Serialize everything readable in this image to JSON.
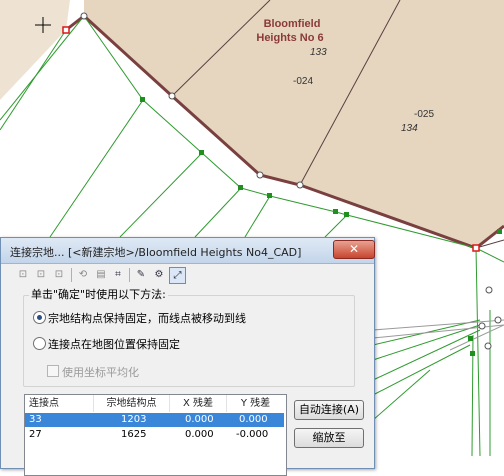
{
  "map": {
    "parcel_name_line1": "Bloomfield",
    "parcel_name_line2": "Heights No 6",
    "labels": [
      "133",
      "-024",
      "-025",
      "134"
    ]
  },
  "dialog": {
    "title": "连接宗地... [<新建宗地>/Bloomfield Heights No4_CAD]",
    "close_glyph": "✕",
    "toolbar_icons": [
      "vertex-tool-1-icon",
      "vertex-tool-2-icon",
      "vertex-tool-3-icon",
      "vertex-tool-4-icon",
      "vertex-tool-5-icon",
      "vertex-tool-6-icon",
      "vertex-tool-7-icon",
      "vertex-tool-8-icon"
    ],
    "group_label": "单击\"确定\"时使用以下方法:",
    "option1": "宗地结构点保持固定，而线点被移动到线",
    "option2": "连接点在地图位置保持固定",
    "checkbox_label": "使用坐标平均化",
    "table": {
      "headers": [
        "连接点",
        "宗地结构点",
        "X 残差",
        "Y 残差"
      ],
      "rows": [
        [
          "33",
          "1203",
          "0.000",
          "0.000"
        ],
        [
          "27",
          "1625",
          "0.000",
          "-0.000"
        ]
      ]
    },
    "auto_connect_label": "自动连接(A)",
    "zoom_label": "缩放至"
  },
  "colors": {
    "parcel_fill": "#e6d6c0",
    "parcel_border": "#7a4040",
    "line_green": "#2f9b2f",
    "selection": "#3a86d8"
  }
}
